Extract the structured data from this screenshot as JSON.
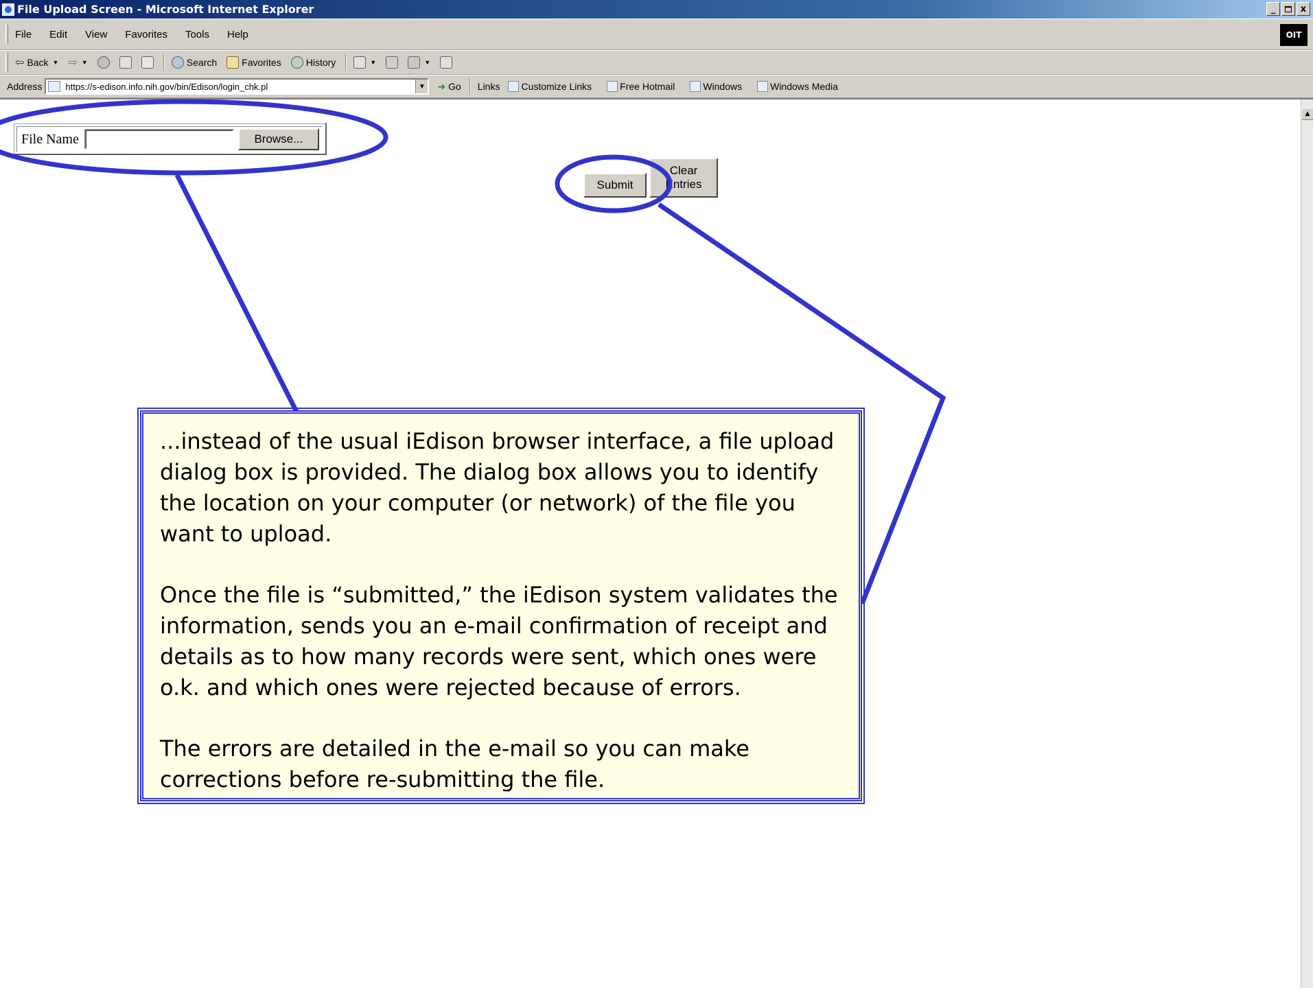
{
  "window": {
    "title": "File Upload Screen - Microsoft Internet Explorer",
    "controls": [
      "_",
      " ",
      "x"
    ]
  },
  "menu": {
    "items": [
      "File",
      "Edit",
      "View",
      "Favorites",
      "Tools",
      "Help"
    ],
    "brand": "OIT"
  },
  "toolbar": {
    "back": "Back",
    "search": "Search",
    "favorites": "Favorites",
    "history": "History"
  },
  "address": {
    "label": "Address",
    "url": "https://s-edison.info.nih.gov/bin/Edison/login_chk.pl",
    "go": "Go",
    "links_label": "Links",
    "links": [
      "Customize Links",
      "Free Hotmail",
      "Windows",
      "Windows Media"
    ]
  },
  "form": {
    "file_label": "File Name",
    "file_value": "",
    "browse": "Browse...",
    "submit": "Submit",
    "clear_line1": "Clear",
    "clear_line2": "Entries"
  },
  "callout": {
    "para1": "...instead of the usual iEdison browser interface, a file upload dialog box is provided.  The dialog box allows you to identify the location on your computer (or network) of the file you want to upload.",
    "para2": "Once the file is “submitted,” the iEdison system validates the information, sends you an e-mail confirmation of receipt and details as to how many records were sent, which ones were o.k. and which ones were rejected because of errors.",
    "para3": "The errors are detailed in the e-mail so you can make corrections before re-submitting the file."
  },
  "colors": {
    "annotation": "#3333cc",
    "callout_bg": "#ffffe6",
    "chrome": "#d4d0c8",
    "titlebar": "#0a246a"
  }
}
